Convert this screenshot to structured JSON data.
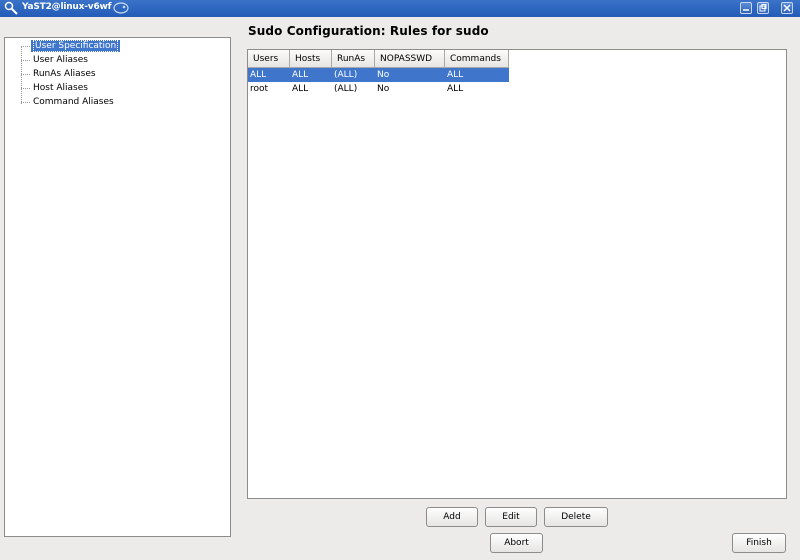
{
  "window": {
    "title": "YaST2@linux-v6wf"
  },
  "tree": {
    "items": [
      {
        "label": "User Specification",
        "selected": true
      },
      {
        "label": "User Aliases"
      },
      {
        "label": "RunAs Aliases"
      },
      {
        "label": "Host Aliases"
      },
      {
        "label": "Command Aliases"
      }
    ]
  },
  "heading": "Sudo Configuration: Rules for sudo",
  "table": {
    "columns": [
      "Users",
      "Hosts",
      "RunAs",
      "NOPASSWD",
      "Commands"
    ],
    "rows": [
      [
        "ALL",
        "ALL",
        "(ALL)",
        "No",
        "ALL"
      ],
      [
        "root",
        "ALL",
        "(ALL)",
        "No",
        "ALL"
      ]
    ]
  },
  "buttons": {
    "add": "Add",
    "edit": "Edit",
    "delete": "Delete",
    "abort": "Abort",
    "finish": "Finish"
  },
  "colors": {
    "titlebar": "#235bb8",
    "selection": "#3f76cc",
    "background": "#ecebe9"
  }
}
